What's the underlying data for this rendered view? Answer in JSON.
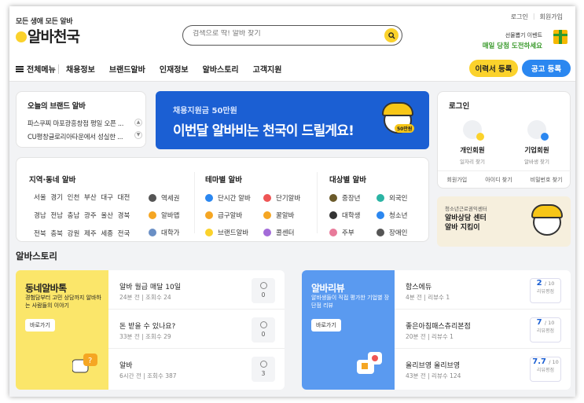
{
  "header": {
    "logo_tagline": "모든 생애 모든 알바",
    "logo_name": "알바천국",
    "search_placeholder": "검색으로 딱! 알바 찾기",
    "top_links": [
      "로그인",
      "회원가입"
    ],
    "promo_line1": "선물뽑기 이벤트",
    "promo_line2": "매일 당첨 도전하세요"
  },
  "nav": {
    "menu_label": "전체메뉴",
    "items": [
      "채용정보",
      "브랜드알바",
      "인재정보",
      "알바스토리",
      "고객지원"
    ],
    "resume_button": "이력서 등록",
    "post_button": "공고 등록"
  },
  "brand": {
    "title": "오늘의 브랜드 알바",
    "lines": [
      "파스쿠찌 마포광흥창점 평일 오픈 ...",
      "CU평창글로리아타운에서 성실한 ..."
    ]
  },
  "banner": {
    "subtitle": "채용지원금 50만원",
    "headline": "이번달 알바비는 천국이 드릴게요!",
    "badge": "50만원"
  },
  "login": {
    "title": "로그인",
    "personal_label": "개인회원",
    "personal_sub": "일자리 찾기",
    "company_label": "기업회원",
    "company_sub": "알바생 찾기",
    "footer": [
      "회원가입",
      "아이디 찾기",
      "비밀번호 찾기"
    ]
  },
  "region": {
    "title": "지역·동네 알바",
    "tags": [
      "서울",
      "경기",
      "인천",
      "부산",
      "대구",
      "대전",
      "경남",
      "전남",
      "충남",
      "광주",
      "울산",
      "경북",
      "전북",
      "충북",
      "강원",
      "제주",
      "세종",
      "전국"
    ],
    "stations": [
      "역세권",
      "알바맵",
      "대학가"
    ]
  },
  "theme": {
    "title": "테마별 알바",
    "col1": [
      "단시간 알바",
      "급구알바",
      "브랜드알바"
    ],
    "col2": [
      "단기알바",
      "꿀알바",
      "콜센터"
    ]
  },
  "target": {
    "title": "대상별 알바",
    "col1": [
      "중장년",
      "대학생",
      "주부"
    ],
    "col2": [
      "외국인",
      "청소년",
      "장애인"
    ]
  },
  "ad": {
    "sub": "청소년근로권익센터",
    "line1": "알바상담 센터",
    "line2": "알바 지킴이"
  },
  "story": {
    "section_title": "알바스토리",
    "left": {
      "title": "동네알바톡",
      "desc": "경험담부터 고민 상담까지 알바하는 사람들의 이야기",
      "button": "바로가기",
      "rows": [
        {
          "title": "알바 월급 매달 10일",
          "meta": "24분 전 | 조회수 24",
          "count": "0"
        },
        {
          "title": "돈 받을 수 있나요?",
          "meta": "33분 전 | 조회수 29",
          "count": "0"
        },
        {
          "title": "알바",
          "meta": "6시간 전 | 조회수 387",
          "count": "3"
        }
      ]
    },
    "right": {
      "title": "알바리뷰",
      "desc": "알바생들이 직접 평가한 기업별 장단점 리뷰",
      "button": "바로가기",
      "rows": [
        {
          "title": "함스에듀",
          "meta": "4분 전 | 리뷰수 1",
          "score": "2",
          "of": "/ 10",
          "label": "리뷰평점"
        },
        {
          "title": "좋은아침패스츄리본점",
          "meta": "20분 전 | 리뷰수 1",
          "score": "7",
          "of": "/ 10",
          "label": "리뷰평점"
        },
        {
          "title": "올리브영 올리브영",
          "meta": "43분 전 | 리뷰수 124",
          "score": "7.7",
          "of": "/ 10",
          "label": "리뷰평점"
        }
      ]
    }
  },
  "colors": {
    "yellow": "#fbd22c",
    "blue": "#2b87f0",
    "banner": "#1b5fd3",
    "story_yellow": "#fbe66a",
    "story_blue": "#5a9af0"
  }
}
